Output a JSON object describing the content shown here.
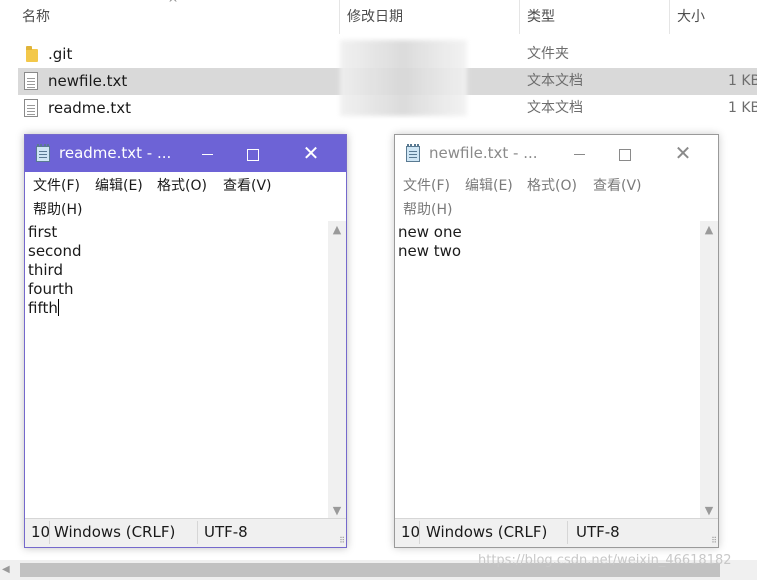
{
  "explorer": {
    "columns": {
      "name": "名称",
      "modified": "修改日期",
      "type": "类型",
      "size": "大小"
    },
    "files": [
      {
        "name": ".git",
        "type": "文件夹",
        "size": "",
        "icon": "folder-icon"
      },
      {
        "name": "newfile.txt",
        "type": "文本文档",
        "size": "1 KB",
        "icon": "text-file-icon"
      },
      {
        "name": "readme.txt",
        "type": "文本文档",
        "size": "1 KB",
        "icon": "text-file-icon"
      }
    ]
  },
  "notepad_left": {
    "title": "readme.txt - ...",
    "menu": [
      "文件(F)",
      "编辑(E)",
      "格式(O)",
      "查看(V)",
      "帮助(H)"
    ],
    "lines": [
      "first",
      "second",
      "third",
      "fourth",
      "fifth"
    ],
    "status": {
      "position": "10",
      "line_ending": "Windows (CRLF)",
      "encoding": "UTF-8"
    },
    "accent": "#6d63d6"
  },
  "notepad_right": {
    "title": "newfile.txt - ...",
    "menu": [
      "文件(F)",
      "编辑(E)",
      "格式(O)",
      "查看(V)",
      "帮助(H)"
    ],
    "lines": [
      "new one",
      "new two"
    ],
    "status": {
      "position": "10",
      "line_ending": "Windows (CRLF)",
      "encoding": "UTF-8"
    }
  },
  "watermark": "https://blog.csdn.net/weixin_46618182"
}
